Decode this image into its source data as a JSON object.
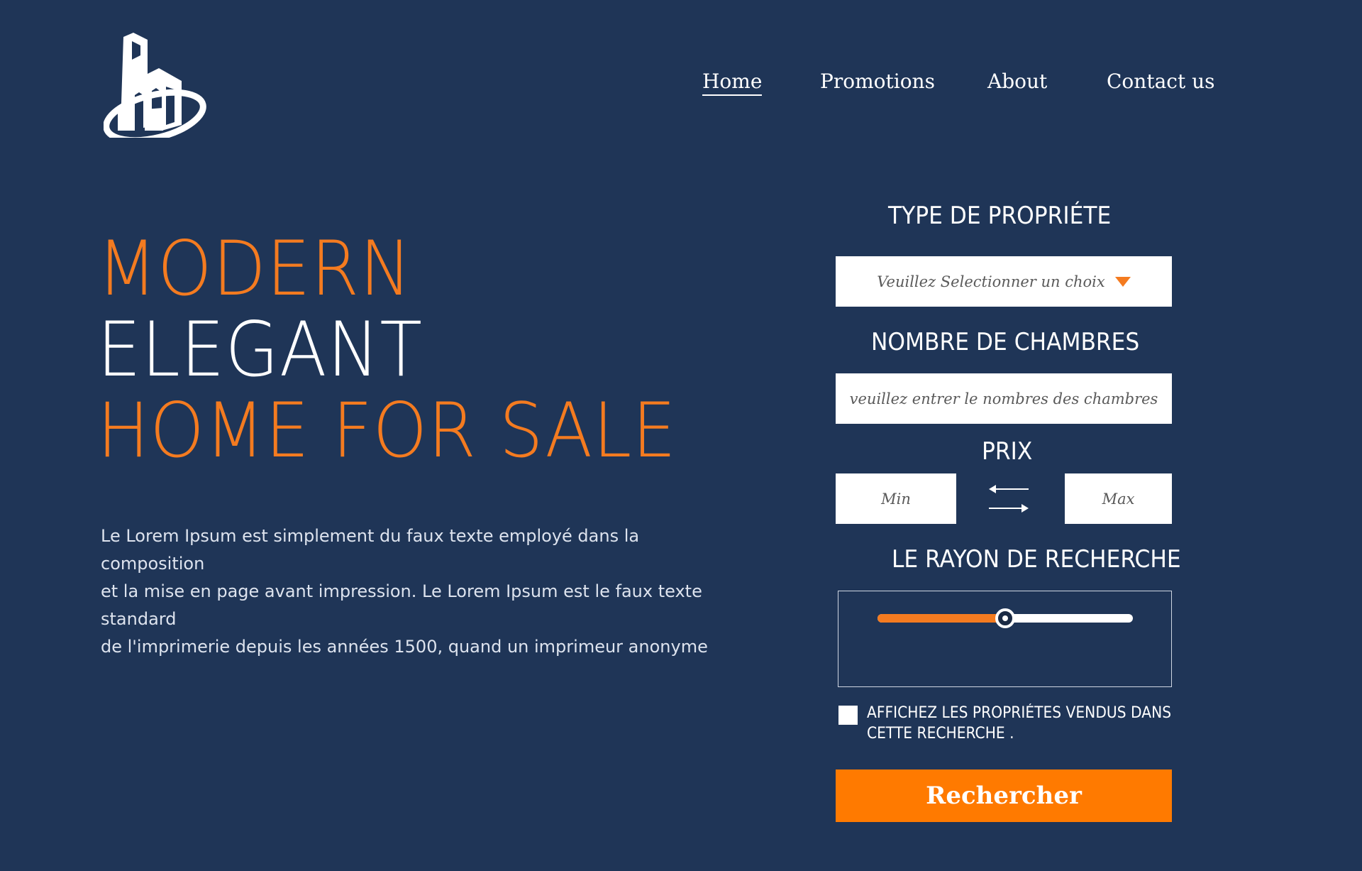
{
  "nav": {
    "items": [
      "Home",
      "Promotions",
      "About",
      "Contact us"
    ]
  },
  "hero": {
    "line1": "MODERN",
    "line2": "ELEGANT",
    "line3": "HOME FOR SALE",
    "description": "Le Lorem Ipsum est simplement du faux texte employé dans la composition\net la mise en page avant impression. Le Lorem Ipsum est le faux texte standard\nde l'imprimerie depuis les années 1500, quand un imprimeur anonyme"
  },
  "form": {
    "property_type_label": "TYPE DE PROPRIÉTE",
    "property_type_placeholder": "Veuillez Selectionner un choix",
    "rooms_label": "NOMBRE DE CHAMBRES",
    "rooms_placeholder": "veuillez entrer le nombres des chambres",
    "price_label": "PRIX",
    "price_min": "Min",
    "price_max": "Max",
    "radius_label": "LE RAYON DE RECHERCHE",
    "radius_value": 0.5,
    "sold_checkbox_label": "AFFICHEZ LES PROPRIÉTES VENDUS DANS CETTE RECHERCHE .",
    "search_button": "Rechercher"
  },
  "colors": {
    "background": "#1f3557",
    "accent": "#f47b20",
    "button": "#ff7a00"
  },
  "icons": {
    "logo": "building-logo-icon",
    "swap": "swap-arrows-icon",
    "dropdown": "caret-down-icon"
  }
}
